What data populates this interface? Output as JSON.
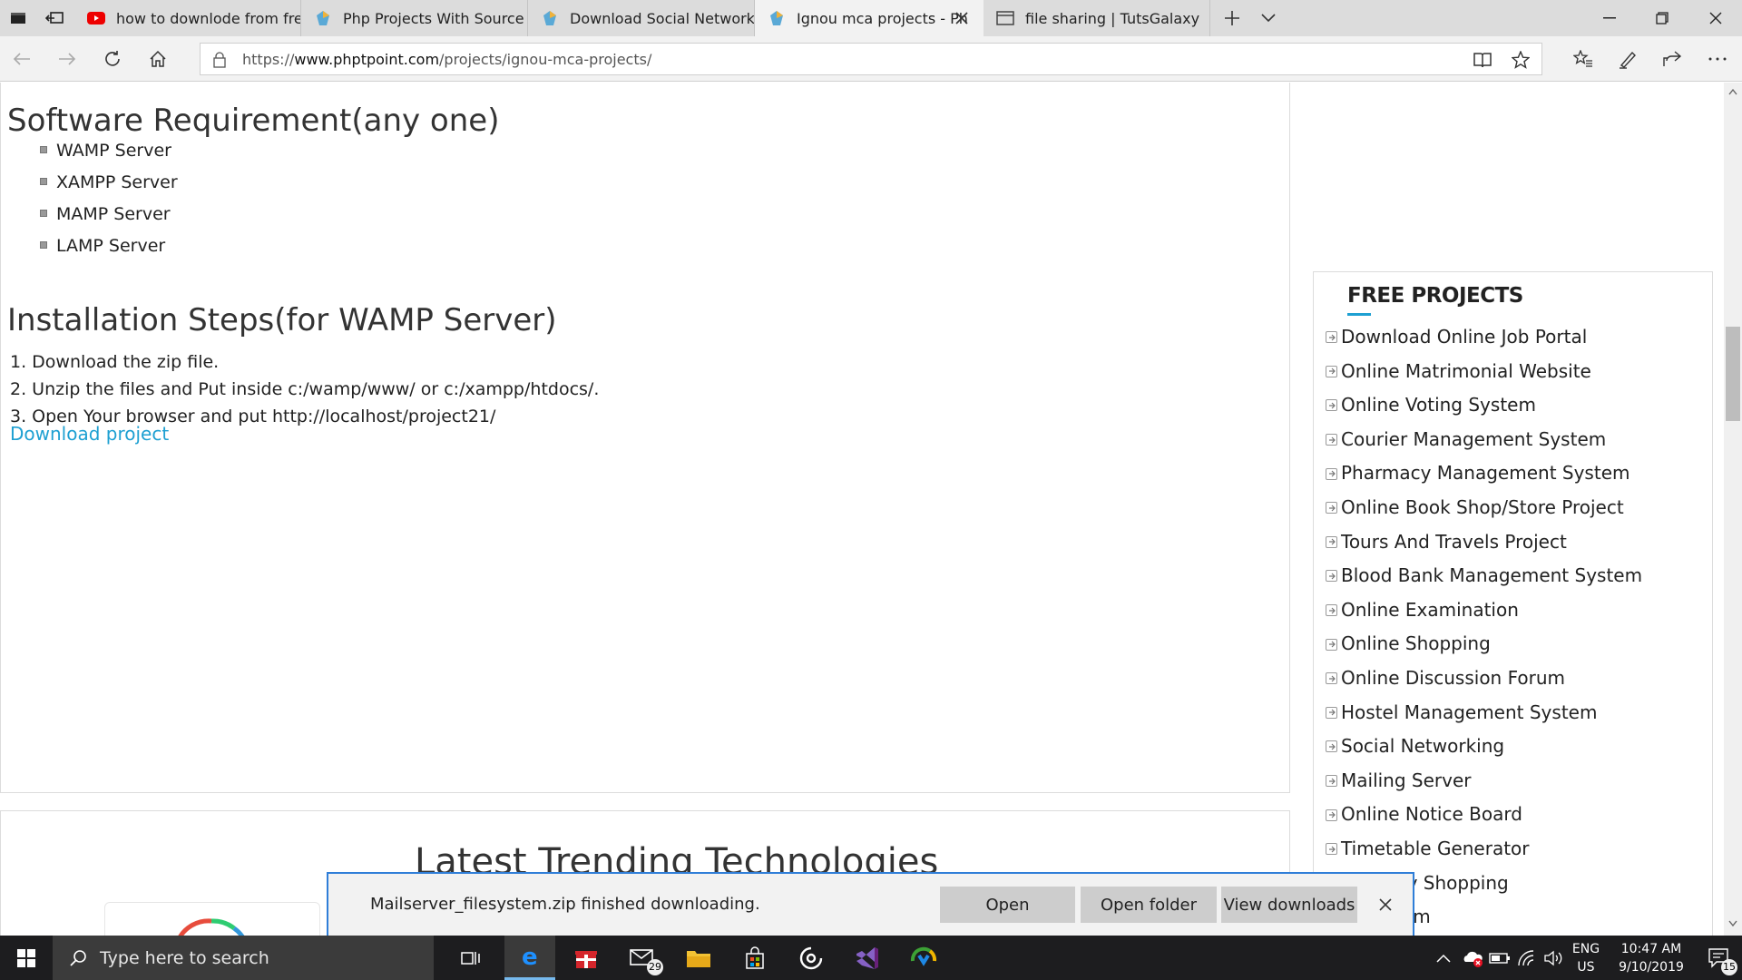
{
  "tabs": [
    {
      "title": "how to downlode from free",
      "icon": "youtube-icon"
    },
    {
      "title": "Php Projects With Source Co",
      "icon": "phptpoint-icon"
    },
    {
      "title": "Download Social Networkin",
      "icon": "phptpoint-icon"
    },
    {
      "title": "Ignou mca projects - Ph",
      "icon": "phptpoint-icon",
      "active": true
    },
    {
      "title": "file sharing | TutsGalaxy",
      "icon": "page-icon"
    }
  ],
  "address": {
    "prefix": "https://",
    "domain": "www.phptpoint.com",
    "path": "/projects/ignou-mca-projects/"
  },
  "content": {
    "software_heading": "Software Requirement(any one)",
    "servers": [
      "WAMP Server",
      "XAMPP Server",
      "MAMP Server",
      "LAMP Server"
    ],
    "install_heading": "Installation Steps(for WAMP Server)",
    "steps": [
      "1. Download the zip file.",
      "2. Unzip the files and Put inside c:/wamp/www/ or c:/xampp/htdocs/.",
      "3. Open Your browser and put http://localhost/project21/"
    ],
    "download_link": "Download project",
    "trending_title": "Latest Trending Technologies"
  },
  "sidebar": {
    "heading": "FREE PROJECTS",
    "items": [
      "Download Online Job Portal",
      "Online Matrimonial Website",
      "Online Voting System",
      "Courier Management System",
      "Pharmacy Management System",
      "Online Book Shop/Store Project",
      "Tours And Travels Project",
      "Blood Bank Management System",
      "Online Examination",
      "Online Shopping",
      "Online Discussion Forum",
      "Hostel Management System",
      "Social Networking",
      "Mailing Server",
      "Online Notice Board",
      "Timetable Generator",
      "ewellery Shopping",
      "al System"
    ]
  },
  "download_bar": {
    "message": "Mailserver_filesystem.zip finished downloading.",
    "open": "Open",
    "open_folder": "Open folder",
    "view_downloads": "View downloads"
  },
  "taskbar": {
    "search_placeholder": "Type here to search",
    "mail_badge": "29",
    "lang": "ENG",
    "region": "US",
    "time": "10:47 AM",
    "date": "9/10/2019",
    "notifications": "15"
  },
  "colors": {
    "link": "#1ea0d2",
    "accent_border": "#2f7ed8",
    "taskbar": "#1d1d1f"
  }
}
